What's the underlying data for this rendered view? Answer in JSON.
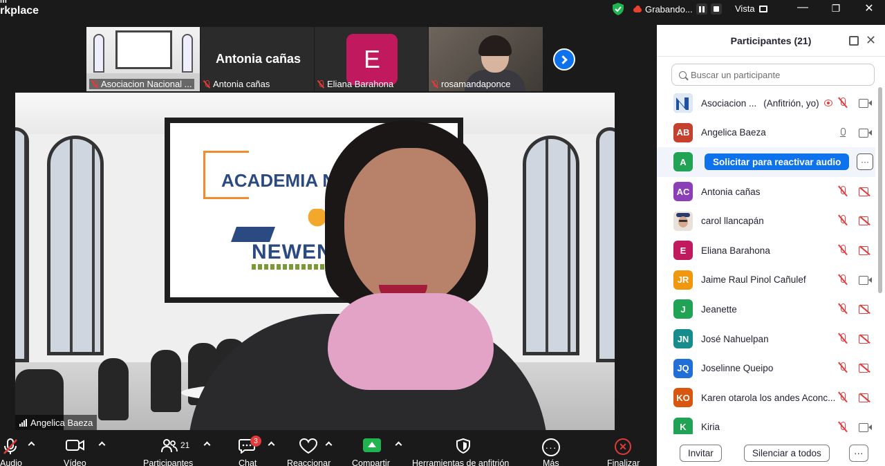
{
  "app": {
    "brand_line1": "m",
    "brand_line2": "rkplace",
    "recording_label": "Grabando...",
    "view_label": "Vista"
  },
  "thumbnails": [
    {
      "label": "Asociacion Nacional ...",
      "type": "video"
    },
    {
      "label": "Antonia cañas",
      "name_display": "Antonia cañas",
      "type": "name"
    },
    {
      "label": "Eliana Barahona",
      "initial": "E",
      "type": "avatar"
    },
    {
      "label": "rosamandaponce",
      "type": "video"
    }
  ],
  "main_video": {
    "speaker": "Angelica Baeza",
    "screen_text": "ACADEMIA NEV",
    "logo_text": "NEWEN"
  },
  "panel": {
    "title": "Participantes (21)",
    "search_placeholder": "Buscar un participante",
    "reactivate_label": "Solicitar para reactivar audio",
    "more_label": "···",
    "participants": [
      {
        "initials": "",
        "name": "Asociacion ...",
        "role": "(Anfitrión, yo)",
        "color": "#1f6fd6",
        "mic": "muted",
        "cam": "on",
        "recording": true
      },
      {
        "initials": "AB",
        "name": "Angelica Baeza",
        "color": "#c5402f",
        "mic": "on",
        "cam": "on"
      },
      {
        "initials": "A",
        "name": "",
        "color": "#21a355",
        "highlighted": true
      },
      {
        "initials": "AC",
        "name": "Antonia cañas",
        "color": "#8a3fb8",
        "mic": "muted",
        "cam": "off"
      },
      {
        "initials": "",
        "name": "carol llancapán",
        "color": "#d8b59c",
        "mic": "muted",
        "cam": "off",
        "photo": true
      },
      {
        "initials": "E",
        "name": "Eliana Barahona",
        "color": "#c0195e",
        "mic": "muted",
        "cam": "off"
      },
      {
        "initials": "JR",
        "name": "Jaime Raul Pinol Cañulef",
        "color": "#f0960f",
        "mic": "muted",
        "cam": "on"
      },
      {
        "initials": "J",
        "name": "Jeanette",
        "color": "#21a355",
        "mic": "muted",
        "cam": "off"
      },
      {
        "initials": "JN",
        "name": "José Nahuelpan",
        "color": "#168c8c",
        "mic": "muted",
        "cam": "off"
      },
      {
        "initials": "JQ",
        "name": "Joselinne Queipo",
        "color": "#1f6fd6",
        "mic": "muted",
        "cam": "off"
      },
      {
        "initials": "KO",
        "name": "Karen otarola  los andes Aconc...",
        "color": "#d9560f",
        "mic": "muted",
        "cam": "off"
      },
      {
        "initials": "K",
        "name": "Kiria",
        "color": "#21a355",
        "mic": "muted",
        "cam": "on"
      }
    ],
    "invite_label": "Invitar",
    "mute_all_label": "Silenciar a todos",
    "footer_more": "···"
  },
  "toolbar": {
    "audio_label": "Audio",
    "video_label": "Vídeo",
    "participants_label": "Participantes",
    "participants_count": "21",
    "chat_label": "Chat",
    "chat_badge": "3",
    "react_label": "Reaccionar",
    "share_label": "Compartir",
    "host_tools_label": "Herramientas de anfitrión",
    "more_label": "Más",
    "end_label": "Finalizar"
  },
  "colors": {
    "accent": "#0e72ed",
    "muted_red": "#e23b3b",
    "share_green": "#20b451"
  }
}
